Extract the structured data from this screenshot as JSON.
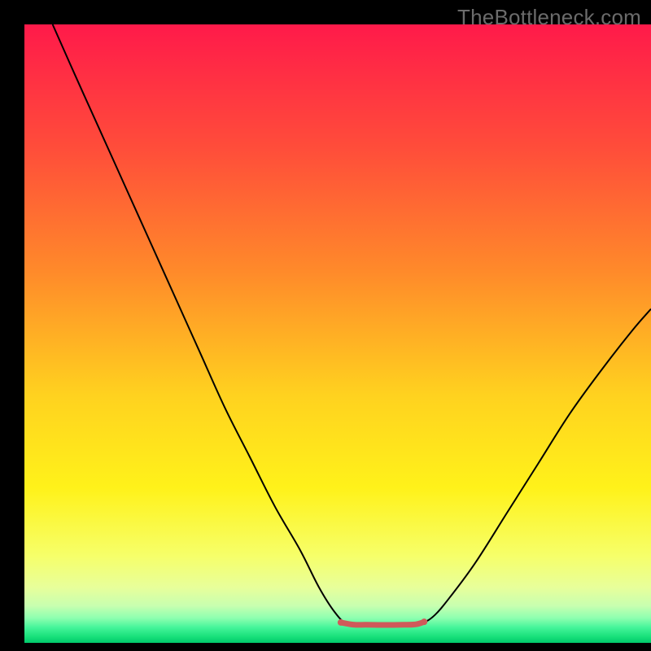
{
  "watermark": "TheBottleneck.com",
  "chart_data": {
    "type": "line",
    "title": "",
    "xlabel": "",
    "ylabel": "",
    "xlim": [
      0,
      100
    ],
    "ylim": [
      0,
      100
    ],
    "gradient_stops": [
      {
        "offset": 0,
        "color": "#ff1a4a"
      },
      {
        "offset": 20,
        "color": "#ff4d3a"
      },
      {
        "offset": 40,
        "color": "#ff8a2a"
      },
      {
        "offset": 60,
        "color": "#ffd21f"
      },
      {
        "offset": 75,
        "color": "#fff21a"
      },
      {
        "offset": 86,
        "color": "#f6ff6a"
      },
      {
        "offset": 91,
        "color": "#e8ff9a"
      },
      {
        "offset": 94,
        "color": "#c8ffb0"
      },
      {
        "offset": 96,
        "color": "#8dffb0"
      },
      {
        "offset": 97.5,
        "color": "#45f59a"
      },
      {
        "offset": 99,
        "color": "#18e07a"
      },
      {
        "offset": 100,
        "color": "#00c96b"
      }
    ],
    "series": [
      {
        "name": "curve",
        "color": "#000000",
        "width": 2,
        "points": [
          {
            "x": 4.5,
            "y": 100.0
          },
          {
            "x": 8.0,
            "y": 92.0
          },
          {
            "x": 12.0,
            "y": 83.0
          },
          {
            "x": 16.0,
            "y": 74.0
          },
          {
            "x": 20.0,
            "y": 65.0
          },
          {
            "x": 24.0,
            "y": 56.0
          },
          {
            "x": 28.0,
            "y": 47.0
          },
          {
            "x": 32.0,
            "y": 38.0
          },
          {
            "x": 36.0,
            "y": 30.0
          },
          {
            "x": 40.0,
            "y": 22.0
          },
          {
            "x": 44.0,
            "y": 15.0
          },
          {
            "x": 47.0,
            "y": 9.0
          },
          {
            "x": 49.5,
            "y": 5.0
          },
          {
            "x": 51.5,
            "y": 3.0
          },
          {
            "x": 53.5,
            "y": 2.94
          },
          {
            "x": 55.5,
            "y": 2.93
          },
          {
            "x": 57.5,
            "y": 2.92
          },
          {
            "x": 59.5,
            "y": 2.93
          },
          {
            "x": 61.5,
            "y": 2.95
          },
          {
            "x": 63.5,
            "y": 3.2
          },
          {
            "x": 65.5,
            "y": 4.5
          },
          {
            "x": 68.0,
            "y": 7.5
          },
          {
            "x": 72.0,
            "y": 13.0
          },
          {
            "x": 77.0,
            "y": 21.0
          },
          {
            "x": 82.0,
            "y": 29.0
          },
          {
            "x": 87.0,
            "y": 37.0
          },
          {
            "x": 92.0,
            "y": 44.0
          },
          {
            "x": 97.0,
            "y": 50.5
          },
          {
            "x": 100.0,
            "y": 54.0
          }
        ]
      },
      {
        "name": "flat-highlight",
        "color": "#cf5a5a",
        "width": 7,
        "cap": "round",
        "points": [
          {
            "x": 50.5,
            "y": 3.3
          },
          {
            "x": 52.5,
            "y": 2.95
          },
          {
            "x": 54.5,
            "y": 2.92
          },
          {
            "x": 56.5,
            "y": 2.9
          },
          {
            "x": 58.5,
            "y": 2.9
          },
          {
            "x": 60.5,
            "y": 2.92
          },
          {
            "x": 62.5,
            "y": 3.0
          },
          {
            "x": 63.8,
            "y": 3.4
          }
        ]
      }
    ],
    "markers": [
      {
        "x": 50.5,
        "y": 3.3,
        "r": 4,
        "color": "#cf5a5a"
      },
      {
        "x": 63.8,
        "y": 3.4,
        "r": 4,
        "color": "#cf5a5a"
      }
    ]
  }
}
